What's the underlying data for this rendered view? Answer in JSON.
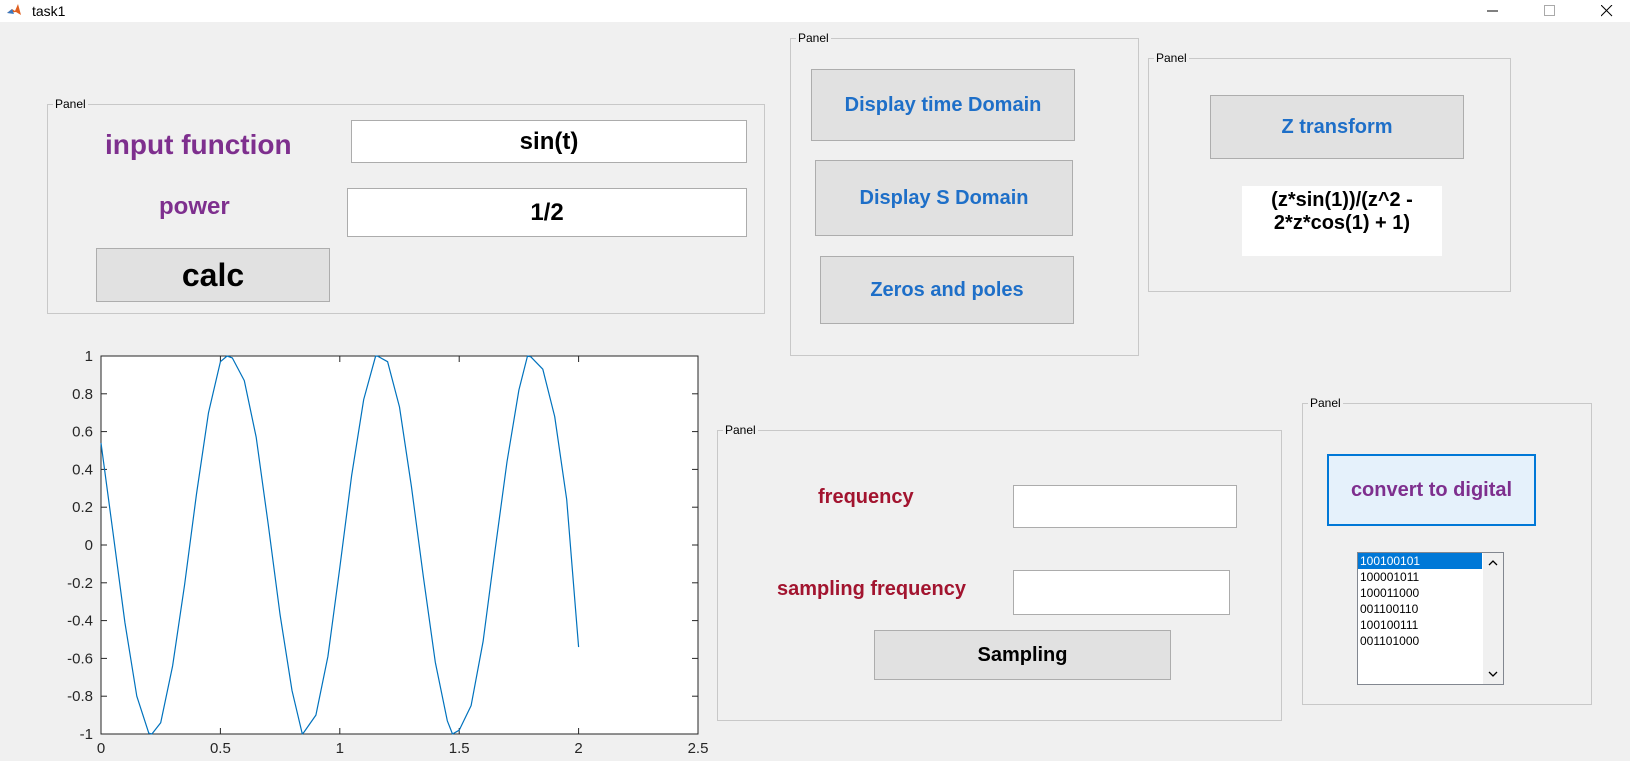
{
  "window": {
    "title": "task1"
  },
  "panels": {
    "input": {
      "title": "Panel",
      "input_function_label": "input function",
      "input_function_value": "sin(t)",
      "power_label": "power",
      "power_value": "1/2",
      "calc_label": "calc"
    },
    "domain": {
      "title": "Panel",
      "time_domain_label": "Display time Domain",
      "s_domain_label": "Display S Domain",
      "zeros_poles_label": "Zeros and poles"
    },
    "ztransform": {
      "title": "Panel",
      "button_label": "Z transform",
      "result_line1": "(z*sin(1))/(z^2 -",
      "result_line2": "2*z*cos(1) + 1)"
    },
    "sampling": {
      "title": "Panel",
      "frequency_label": "frequency",
      "frequency_value": "",
      "sampling_frequency_label": "sampling frequency",
      "sampling_frequency_value": "",
      "button_label": "Sampling"
    },
    "digital": {
      "title": "Panel",
      "button_label": "convert to digital",
      "list": [
        "100100101",
        "100001011",
        "100011000",
        "001100110",
        "100100111",
        "001101000"
      ],
      "selected_index": 0
    }
  },
  "icons": {
    "app": "matlab-icon",
    "minimize": "minimize-icon",
    "maximize": "maximize-icon",
    "close": "close-icon",
    "scroll_up": "chevron-up-icon",
    "scroll_down": "chevron-down-icon"
  },
  "colors": {
    "purple": "#7e2f8e",
    "maroon": "#a2142f",
    "blue_text": "#1e6fc8",
    "plot_line": "#0072bd"
  },
  "chart_data": {
    "type": "line",
    "title": "",
    "xlabel": "",
    "ylabel": "",
    "xlim": [
      0,
      2.5
    ],
    "ylim": [
      -1,
      1
    ],
    "xticks": [
      0,
      0.5,
      1,
      1.5,
      2,
      2.5
    ],
    "xtick_labels": [
      "0",
      "0.5",
      "1",
      "1.5",
      "2",
      "2.5"
    ],
    "yticks": [
      -1,
      -0.8,
      -0.6,
      -0.4,
      -0.2,
      0,
      0.2,
      0.4,
      0.6,
      0.8,
      1
    ],
    "ytick_labels": [
      "-1",
      "-0.8",
      "-0.6",
      "-0.4",
      "-0.2",
      "0",
      "0.2",
      "0.4",
      "0.6",
      "0.8",
      "1"
    ],
    "grid": false,
    "series": [
      {
        "x": [
          0,
          0.05,
          0.1,
          0.15,
          0.2,
          0.213,
          0.25,
          0.3,
          0.35,
          0.4,
          0.45,
          0.5,
          0.528,
          0.55,
          0.6,
          0.65,
          0.7,
          0.75,
          0.8,
          0.843,
          0.85,
          0.9,
          0.95,
          1.0,
          1.05,
          1.1,
          1.15,
          1.157,
          1.2,
          1.25,
          1.3,
          1.35,
          1.4,
          1.45,
          1.472,
          1.5,
          1.55,
          1.6,
          1.65,
          1.7,
          1.75,
          1.786,
          1.8,
          1.85,
          1.9,
          1.95,
          2.0
        ],
        "y": [
          0.54,
          0.07,
          -0.41,
          -0.8,
          -0.996,
          -1.0,
          -0.94,
          -0.64,
          -0.21,
          0.27,
          0.7,
          0.97,
          1.0,
          0.99,
          0.87,
          0.57,
          0.11,
          -0.37,
          -0.77,
          -1.0,
          -0.99,
          -0.9,
          -0.59,
          -0.12,
          0.37,
          0.77,
          0.999,
          1.0,
          0.97,
          0.73,
          0.31,
          -0.17,
          -0.62,
          -0.93,
          -1.0,
          -0.98,
          -0.85,
          -0.51,
          -0.03,
          0.44,
          0.82,
          1.0,
          0.996,
          0.93,
          0.68,
          0.24,
          -0.54
        ]
      }
    ]
  }
}
